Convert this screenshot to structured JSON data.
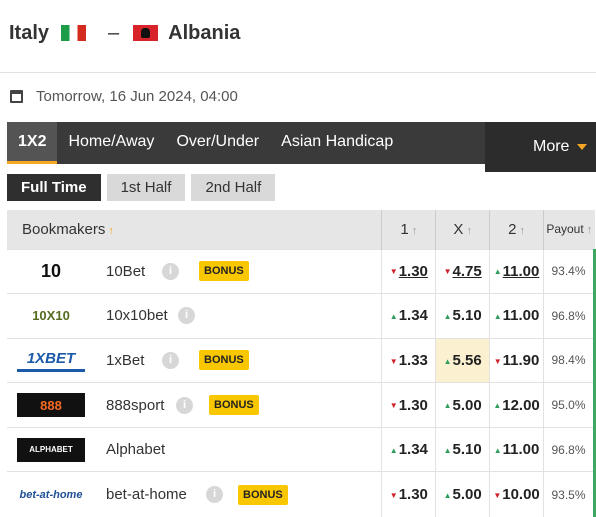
{
  "match": {
    "home": "Italy",
    "separator": "–",
    "away": "Albania"
  },
  "date": "Tomorrow, 16 Jun 2024, 04:00",
  "tabs": [
    "1X2",
    "Home/Away",
    "Over/Under",
    "Asian Handicap"
  ],
  "more_label": "More",
  "halfs": [
    "Full Time",
    "1st Half",
    "2nd Half"
  ],
  "table": {
    "headers": {
      "bookmakers": "Bookmakers",
      "one": "1",
      "x": "X",
      "two": "2",
      "payout": "Payout"
    },
    "rows": [
      {
        "name": "10Bet",
        "logo": "10",
        "bonus": "BONUS",
        "one": "1.30",
        "x": "4.75",
        "two": "11.00",
        "payout": "93.4%"
      },
      {
        "name": "10x10bet",
        "logo": "10X10",
        "bonus": "",
        "one": "1.34",
        "x": "5.10",
        "two": "11.00",
        "payout": "96.8%"
      },
      {
        "name": "1xBet",
        "logo": "1XBET",
        "bonus": "BONUS",
        "one": "1.33",
        "x": "5.56",
        "two": "11.90",
        "payout": "98.4%"
      },
      {
        "name": "888sport",
        "logo": "888",
        "bonus": "BONUS",
        "one": "1.30",
        "x": "5.00",
        "two": "12.00",
        "payout": "95.0%"
      },
      {
        "name": "Alphabet",
        "logo": "ALPHABET",
        "bonus": "",
        "one": "1.34",
        "x": "5.10",
        "two": "11.00",
        "payout": "96.8%"
      },
      {
        "name": "bet-at-home",
        "logo": "bet-at-home",
        "bonus": "BONUS",
        "one": "1.30",
        "x": "5.00",
        "two": "10.00",
        "payout": "93.5%"
      }
    ]
  },
  "colors": {
    "accent": "#f5a623",
    "up": "#2e9e5e",
    "down": "#d0202a",
    "bonus": "#f9c700"
  }
}
